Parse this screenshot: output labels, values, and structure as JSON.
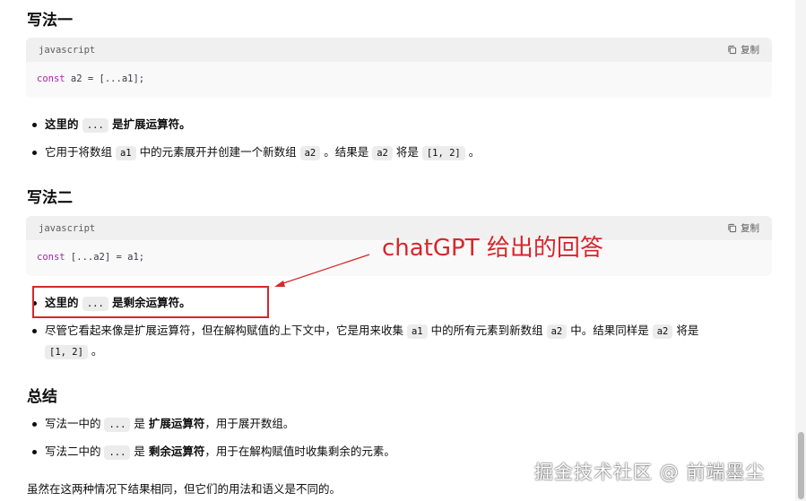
{
  "section1": {
    "title": "写法一",
    "code": {
      "lang": "javascript",
      "copy_label": "复制",
      "keyword": "const",
      "rest": " a2 = [...a1];"
    },
    "bullets": [
      {
        "pre": "这里的 ",
        "code": "...",
        "post": " 是扩展运算符。"
      },
      {
        "pre": "它用于将数组 ",
        "c1": "a1",
        "m1": " 中的元素展开并创建一个新数组 ",
        "c2": "a2",
        "m2": " 。结果是 ",
        "c3": "a2",
        "m3": " 将是 ",
        "c4": "[1, 2]",
        "post": " 。"
      }
    ]
  },
  "section2": {
    "title": "写法二",
    "code": {
      "lang": "javascript",
      "copy_label": "复制",
      "keyword": "const",
      "rest": " [...a2] = a1;"
    },
    "bullets": [
      {
        "pre": "这里的 ",
        "code": "...",
        "post": " 是剩余运算符。"
      },
      {
        "pre": "尽管它看起来像是扩展运算符，但在解构赋值的上下文中，它是用来收集 ",
        "c1": "a1",
        "m1": " 中的所有元素到新数组 ",
        "c2": "a2",
        "m2": " 中。结果同样是 ",
        "c3": "a2",
        "m3": " 将是",
        "c4": "[1, 2]",
        "post": " 。"
      }
    ]
  },
  "annotation": {
    "text": "chatGPT 给出的回答",
    "color": "#d8262a"
  },
  "summary": {
    "title": "总结",
    "bullets": [
      {
        "pre": "写法一中的 ",
        "code": "...",
        "mid": " 是 ",
        "bold": "扩展运算符",
        "post": "，用于展开数组。"
      },
      {
        "pre": "写法二中的 ",
        "code": "...",
        "mid": " 是 ",
        "bold": "剩余运算符",
        "post": "，用于在解构赋值时收集剩余的元素。"
      }
    ],
    "closing": "虽然在这两种情况下结果相同，但它们的用法和语义是不同的。"
  },
  "watermark": "掘金技术社区 @ 前端墨尘"
}
